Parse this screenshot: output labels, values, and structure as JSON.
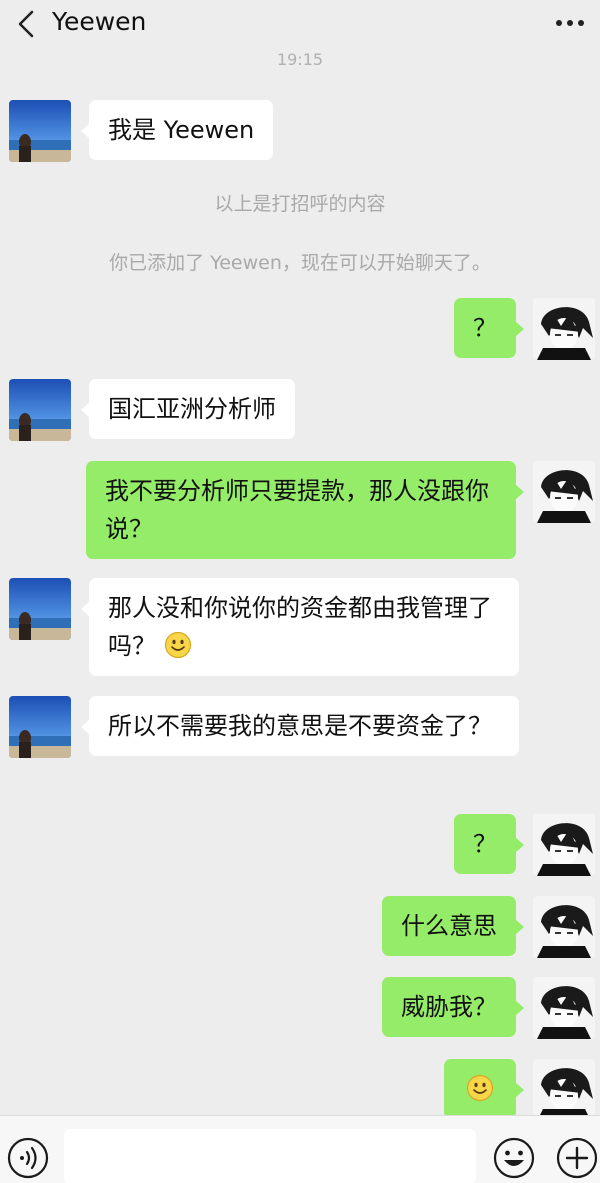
{
  "header": {
    "title": "Yeewen"
  },
  "chat": {
    "timestamp": "19:15",
    "contact_intro": "我是 Yeewen",
    "greeting_note": "以上是打招呼的内容",
    "added_note": "你已添加了 Yeewen，现在可以开始聊天了。",
    "messages": [
      {
        "side": "right",
        "text": "？"
      },
      {
        "side": "left",
        "text": "国汇亚洲分析师"
      },
      {
        "side": "right",
        "text": "我不要分析师只要提款，那人没跟你说？"
      },
      {
        "side": "left",
        "text": "那人没和你说你的资金都由我管理了吗？"
      },
      {
        "side": "left",
        "text": "所以不需要我的意思是不要资金了？"
      },
      {
        "side": "right",
        "text": "？"
      },
      {
        "side": "right",
        "text": "什么意思"
      },
      {
        "side": "right",
        "text": "威胁我？"
      },
      {
        "side": "right",
        "text": ""
      }
    ],
    "emoji_icon": "smile-emoji-icon"
  },
  "input_bar": {
    "voice_icon": "voice-icon",
    "emoji_icon": "emoji-icon",
    "plus_icon": "plus-icon",
    "input_value": ""
  },
  "colors": {
    "background": "#ededed",
    "sent_bubble": "#95ec69",
    "received_bubble": "#ffffff",
    "system_text": "#a9a9a9"
  }
}
